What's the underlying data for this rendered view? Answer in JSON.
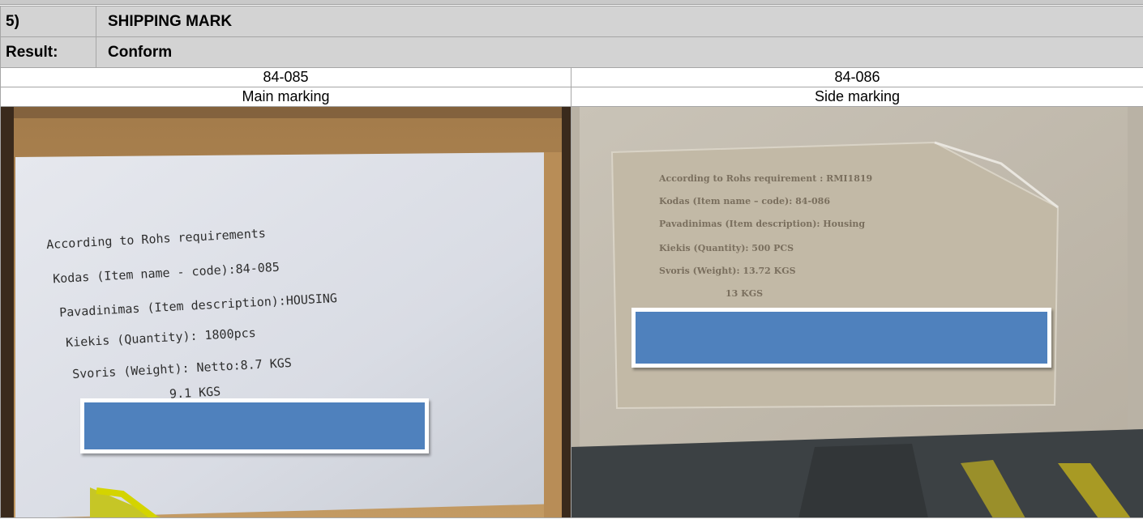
{
  "section": {
    "number": "5)",
    "title": "SHIPPING MARK"
  },
  "result": {
    "label": "Result:",
    "value": "Conform"
  },
  "photos": [
    {
      "item_code": "84-085",
      "caption": "Main marking",
      "label_lines": [
        "According to Rohs requirements",
        "Kodas (Item name - code):84-085",
        "Pavadinimas (Item description):HOUSING",
        "Kiekis (Quantity):  1800pcs",
        "Svoris (Weight):      Netto:8.7 KGS",
        "9.1 KGS"
      ]
    },
    {
      "item_code": "84-086",
      "caption": "Side marking",
      "label_lines": [
        "According to Rohs requirement  :  RMI1819",
        "Kodas (Item name – code): 84-086",
        "Pavadinimas (Item description): Housing",
        "Kiekis (Quantity):    500  PCS",
        "Svoris (Weight):    13.72  KGS",
        "13  KGS"
      ]
    }
  ],
  "colors": {
    "header_bg": "#d3d3d3",
    "redaction": "#4f81bd",
    "border": "#a6a6a6"
  }
}
